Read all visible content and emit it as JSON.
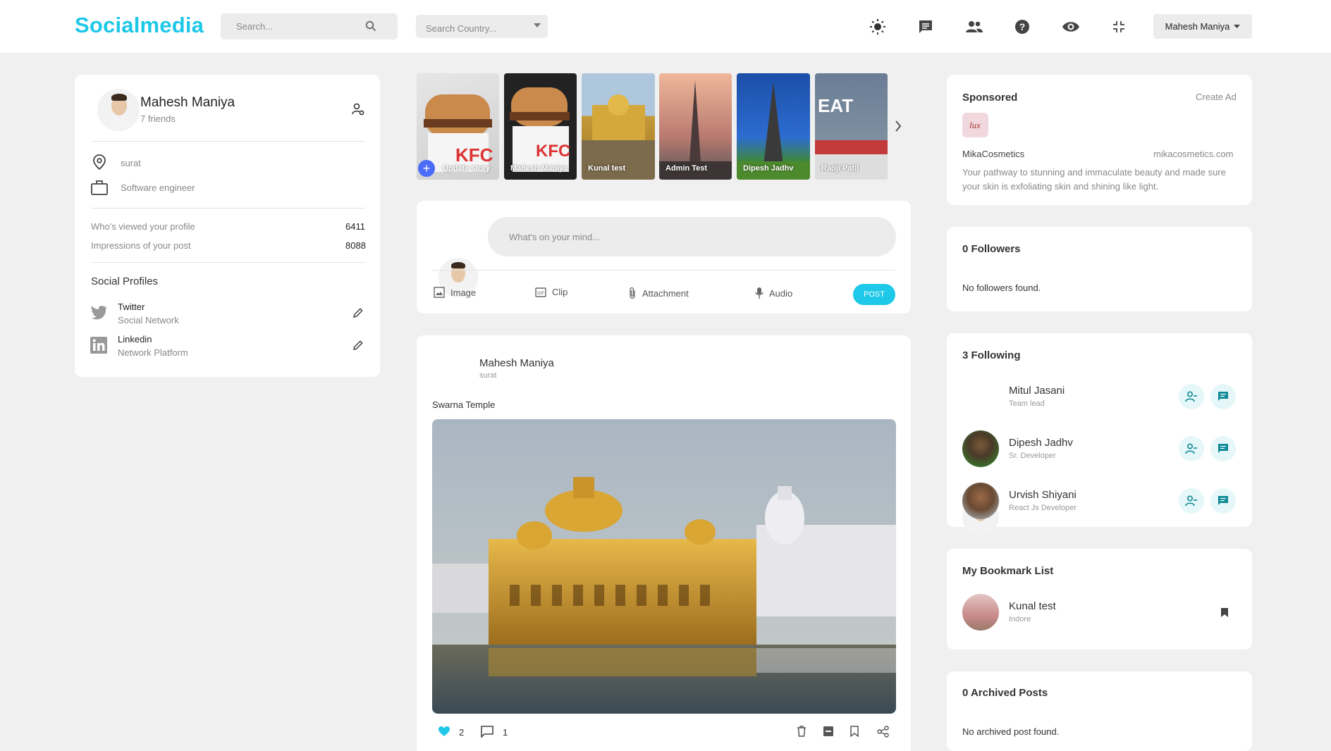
{
  "header": {
    "logo": "Socialmedia",
    "search_placeholder": "Search...",
    "country_placeholder": "Search Country...",
    "user_menu": "Mahesh Maniya"
  },
  "profile": {
    "name": "Mahesh Maniya",
    "friends": "7 friends",
    "location": "surat",
    "job": "Software engineer",
    "stats": [
      {
        "label": "Who's viewed your profile",
        "value": "6411"
      },
      {
        "label": "Impressions of your post",
        "value": "8088"
      }
    ],
    "social_title": "Social Profiles",
    "socials": [
      {
        "name": "Twitter",
        "sub": "Social Network"
      },
      {
        "name": "Linkedin",
        "sub": "Network Platform"
      }
    ]
  },
  "stories": [
    {
      "label": "Update story"
    },
    {
      "label": "Mahesh Maniya"
    },
    {
      "label": "Kunal test"
    },
    {
      "label": "Admin Test"
    },
    {
      "label": "Dipesh Jadhv"
    },
    {
      "label": "Raoji Patil"
    }
  ],
  "composer": {
    "placeholder": "What's on your mind...",
    "actions": [
      "Image",
      "Clip",
      "Attachment",
      "Audio"
    ],
    "post_label": "POST"
  },
  "post": {
    "author": "Mahesh Maniya",
    "location": "surat",
    "caption": "Swarna Temple",
    "likes": "2",
    "comments": "1"
  },
  "sponsored": {
    "title": "Sponsored",
    "create_ad": "Create Ad",
    "brand": "MikaCosmetics",
    "url": "mikacosmetics.com",
    "desc": "Your pathway to stunning and immaculate beauty and made sure your skin is exfoliating skin and shining like light."
  },
  "followers": {
    "title": "0 Followers",
    "empty": "No followers found."
  },
  "following": {
    "title": "3 Following",
    "people": [
      {
        "name": "Mitul Jasani",
        "role": "Team lead"
      },
      {
        "name": "Dipesh Jadhv",
        "role": "Sr. Developer"
      },
      {
        "name": "Urvish Shiyani",
        "role": "React Js Developer"
      }
    ]
  },
  "bookmarks": {
    "title": "My Bookmark List",
    "item_name": "Kunal test",
    "item_sub": "Indore"
  },
  "archived": {
    "title": "0 Archived Posts",
    "empty": "No archived post found."
  },
  "colors": {
    "accent": "#1ec8e8",
    "teal": "#0e8a96",
    "heart": "#1ec8e8"
  }
}
